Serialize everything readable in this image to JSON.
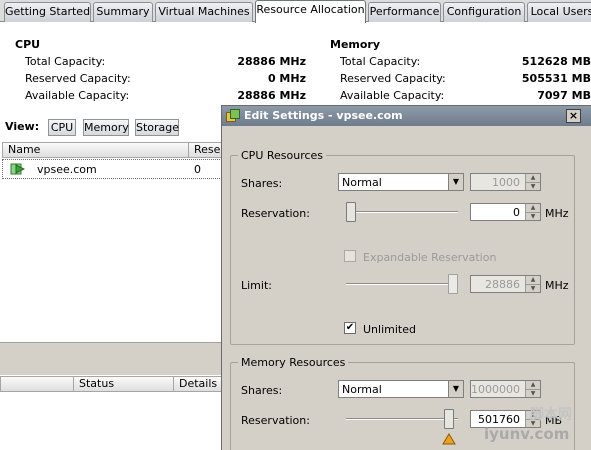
{
  "tabs": [
    {
      "label": "Getting Started"
    },
    {
      "label": "Summary"
    },
    {
      "label": "Virtual Machines"
    },
    {
      "label": "Resource Allocation"
    },
    {
      "label": "Performance"
    },
    {
      "label": "Configuration"
    },
    {
      "label": "Local Users"
    }
  ],
  "cpu": {
    "header": "CPU",
    "total_label": "Total Capacity:",
    "total_value": "28886 MHz",
    "reserved_label": "Reserved Capacity:",
    "reserved_value": "0 MHz",
    "available_label": "Available Capacity:",
    "available_value": "28886 MHz"
  },
  "memory": {
    "header": "Memory",
    "total_label": "Total Capacity:",
    "total_value": "512628 MB",
    "reserved_label": "Reserved Capacity:",
    "reserved_value": "505531 MB",
    "available_label": "Available Capacity:",
    "available_value": "7097 MB"
  },
  "view": {
    "label": "View:",
    "buttons": [
      "CPU",
      "Memory",
      "Storage"
    ]
  },
  "table": {
    "columns": [
      "Name",
      "Reser"
    ],
    "rows": [
      {
        "name": "vpsee.com",
        "reservation": "0"
      }
    ]
  },
  "bottom_table": {
    "columns": [
      "Status",
      "Details"
    ]
  },
  "dialog": {
    "title": "Edit Settings - vpsee.com",
    "close_glyph": "×",
    "cpu_group": {
      "title": "CPU Resources",
      "shares_label": "Shares:",
      "shares_value": "Normal",
      "shares_number": "1000",
      "reservation_label": "Reservation:",
      "reservation_value": "0",
      "reservation_unit": "MHz",
      "expandable_label": "Expandable Reservation",
      "limit_label": "Limit:",
      "limit_value": "28886",
      "limit_unit": "MHz",
      "unlimited_label": "Unlimited",
      "unlimited_checked": true,
      "reservation_slider_fraction": 0.0,
      "limit_slider_fraction": 1.0
    },
    "memory_group": {
      "title": "Memory Resources",
      "shares_label": "Shares:",
      "shares_value": "Normal",
      "shares_number": "1000000",
      "reservation_label": "Reservation:",
      "reservation_value": "501760",
      "reservation_unit": "MB",
      "reservation_slider_fraction": 0.98
    }
  },
  "watermark": {
    "cn": "脚本网",
    "site": "iyunv.com"
  }
}
